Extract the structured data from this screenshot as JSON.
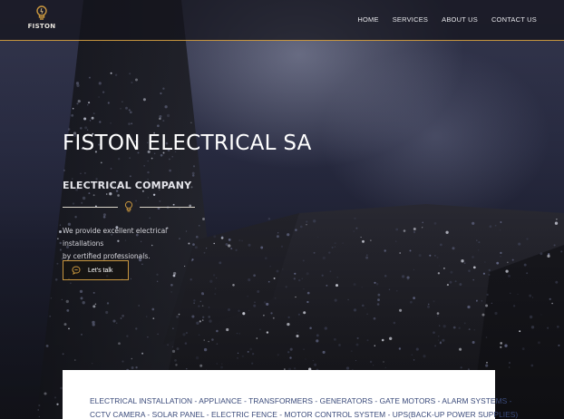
{
  "brand": {
    "name": "FISTON",
    "accent": "#c8963e"
  },
  "nav": {
    "items": [
      "HOME",
      "SERVICES",
      "ABOUT US",
      "CONTACT US"
    ]
  },
  "hero": {
    "title": "FISTON ELECTRICAL SA",
    "subtitle": "ELECTRICAL COMPANY",
    "description_line1": "We provide excellent electrical installations",
    "description_line2": "by certified professionals.",
    "cta_label": "Let's talk",
    "cta_icon": "chat-bubble-icon",
    "divider_icon": "lightbulb-icon"
  },
  "services": {
    "line1": "ELECTRICAL INSTALLATION - APPLIANCE - TRANSFORMERS - GENERATORS - GATE MOTORS - ALARM SYSTEMS -",
    "line2": "CCTV CAMERA - SOLAR PANEL - ELECTRIC FENCE - MOTOR CONTROL SYSTEM - UPS(BACK-UP POWER SUPPLIES)"
  }
}
